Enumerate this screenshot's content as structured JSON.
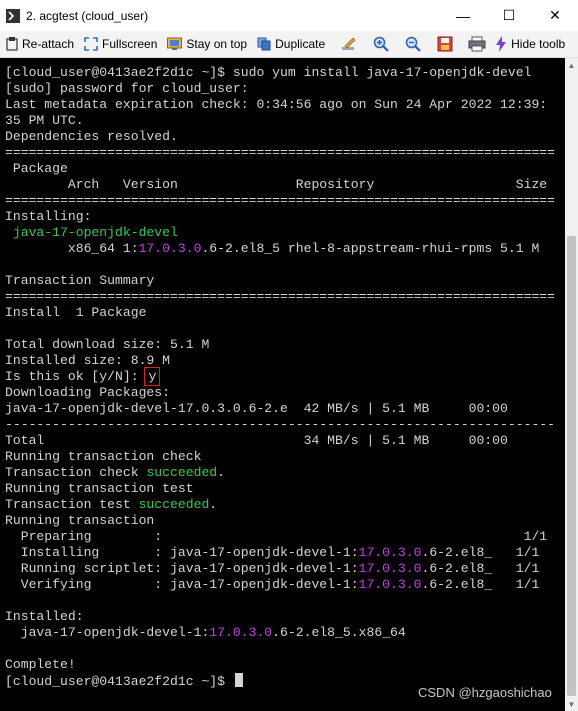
{
  "window": {
    "title": "2. acgtest (cloud_user)",
    "controls": {
      "minimize": "—",
      "maximize": "☐",
      "close": "✕"
    }
  },
  "toolbar": {
    "reattach": "Re-attach",
    "fullscreen": "Fullscreen",
    "stay_on_top": "Stay on top",
    "duplicate": "Duplicate",
    "hide_toolbar": "Hide toolb"
  },
  "terminal": {
    "lines": [
      {
        "parts": [
          {
            "text": "[cloud_user@0413ae2f2d1c ~]$ sudo yum install java-17-openjdk-devel"
          }
        ]
      },
      {
        "parts": [
          {
            "text": "[sudo] password for cloud_user:"
          }
        ]
      },
      {
        "parts": [
          {
            "text": "Last metadata expiration check: 0:34:56 ago on Sun 24 Apr 2022 12:39:"
          }
        ]
      },
      {
        "parts": [
          {
            "text": "35 PM UTC."
          }
        ]
      },
      {
        "parts": [
          {
            "text": "Dependencies resolved."
          }
        ]
      },
      {
        "parts": [
          {
            "text": "======================================================================"
          }
        ]
      },
      {
        "parts": [
          {
            "text": " Package"
          }
        ]
      },
      {
        "parts": [
          {
            "text": "        Arch   Version               Repository                  Size"
          }
        ]
      },
      {
        "parts": [
          {
            "text": "======================================================================"
          }
        ]
      },
      {
        "parts": [
          {
            "text": "Installing:"
          }
        ]
      },
      {
        "parts": [
          {
            "text": " "
          },
          {
            "text": "java-17-openjdk-devel",
            "style": "green"
          }
        ]
      },
      {
        "parts": [
          {
            "text": "        x86_64 1:"
          },
          {
            "text": "17.0.3.0",
            "style": "magenta"
          },
          {
            "text": ".6-2.el8_5 rhel-8-appstream-rhui-rpms 5.1 M"
          }
        ]
      },
      {
        "parts": [
          {
            "text": ""
          }
        ]
      },
      {
        "parts": [
          {
            "text": "Transaction Summary"
          }
        ]
      },
      {
        "parts": [
          {
            "text": "======================================================================"
          }
        ]
      },
      {
        "parts": [
          {
            "text": "Install  1 Package"
          }
        ]
      },
      {
        "parts": [
          {
            "text": ""
          }
        ]
      },
      {
        "parts": [
          {
            "text": "Total download size: 5.1 M"
          }
        ]
      },
      {
        "parts": [
          {
            "text": "Installed size: 8.9 M"
          }
        ]
      },
      {
        "parts": [
          {
            "text": "Is this ok [y/N]: "
          },
          {
            "text": "y",
            "style": "boxed"
          }
        ]
      },
      {
        "parts": [
          {
            "text": "Downloading Packages:"
          }
        ]
      },
      {
        "parts": [
          {
            "text": "java-17-openjdk-devel-17.0.3.0.6-2.e  42 MB/s | 5.1 MB     00:00"
          }
        ]
      },
      {
        "parts": [
          {
            "text": "----------------------------------------------------------------------"
          }
        ]
      },
      {
        "parts": [
          {
            "text": "Total                                 34 MB/s | 5.1 MB     00:00"
          }
        ]
      },
      {
        "parts": [
          {
            "text": "Running transaction check"
          }
        ]
      },
      {
        "parts": [
          {
            "text": "Transaction check "
          },
          {
            "text": "succeeded",
            "style": "green"
          },
          {
            "text": "."
          }
        ]
      },
      {
        "parts": [
          {
            "text": "Running transaction test"
          }
        ]
      },
      {
        "parts": [
          {
            "text": "Transaction test "
          },
          {
            "text": "succeeded",
            "style": "green"
          },
          {
            "text": "."
          }
        ]
      },
      {
        "parts": [
          {
            "text": "Running transaction"
          }
        ]
      },
      {
        "parts": [
          {
            "text": "  Preparing        :                                              1/1"
          }
        ]
      },
      {
        "parts": [
          {
            "text": "  Installing       : java-17-openjdk-devel-1:"
          },
          {
            "text": "17.0.3.0",
            "style": "magenta"
          },
          {
            "text": ".6-2.el8_   1/1"
          }
        ]
      },
      {
        "parts": [
          {
            "text": "  Running scriptlet: java-17-openjdk-devel-1:"
          },
          {
            "text": "17.0.3.0",
            "style": "magenta"
          },
          {
            "text": ".6-2.el8_   1/1"
          }
        ]
      },
      {
        "parts": [
          {
            "text": "  Verifying        : java-17-openjdk-devel-1:"
          },
          {
            "text": "17.0.3.0",
            "style": "magenta"
          },
          {
            "text": ".6-2.el8_   1/1"
          }
        ]
      },
      {
        "parts": [
          {
            "text": ""
          }
        ]
      },
      {
        "parts": [
          {
            "text": "Installed:"
          }
        ]
      },
      {
        "parts": [
          {
            "text": "  java-17-openjdk-devel-1:"
          },
          {
            "text": "17.0.3.0",
            "style": "magenta"
          },
          {
            "text": ".6-2.el8_5.x86_64"
          }
        ]
      },
      {
        "parts": [
          {
            "text": ""
          }
        ]
      },
      {
        "parts": [
          {
            "text": "Complete!"
          }
        ]
      },
      {
        "parts": [
          {
            "text": "[cloud_user@0413ae2f2d1c ~]$ "
          }
        ],
        "cursor": true
      }
    ]
  },
  "watermark": "CSDN @hzgaoshichao",
  "colors": {
    "terminal_bg": "#000000",
    "terminal_fg": "#d4d4d4",
    "green": "#27d04b",
    "magenta": "#c33ee6",
    "highlight_box": "#e0201a"
  }
}
